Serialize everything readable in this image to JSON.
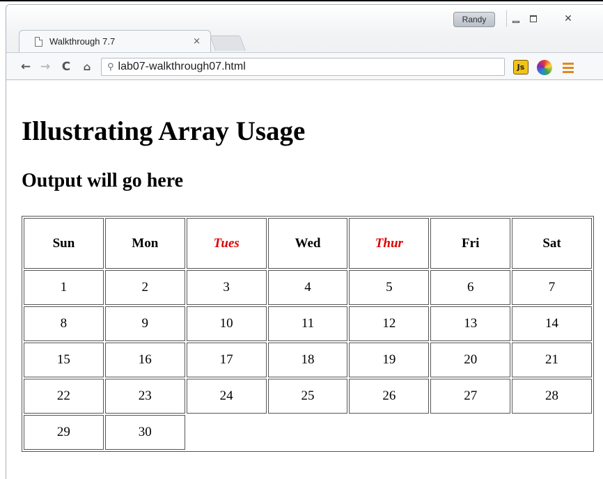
{
  "browser": {
    "user_badge": "Randy",
    "tab": {
      "title": "Walkthrough 7.7",
      "close": "×"
    },
    "address": "lab07-walkthrough07.html",
    "nav": {
      "back": "←",
      "forward": "→",
      "reload": "C",
      "home": "⌂"
    },
    "extensions": {
      "js_label": "Js"
    },
    "window_close": "✕"
  },
  "page": {
    "heading": "Illustrating Array Usage",
    "subheading": "Output will go here",
    "days": [
      {
        "label": "Sun",
        "highlight": false
      },
      {
        "label": "Mon",
        "highlight": false
      },
      {
        "label": "Tues",
        "highlight": true
      },
      {
        "label": "Wed",
        "highlight": false
      },
      {
        "label": "Thur",
        "highlight": true
      },
      {
        "label": "Fri",
        "highlight": false
      },
      {
        "label": "Sat",
        "highlight": false
      }
    ],
    "weeks": [
      [
        "1",
        "2",
        "3",
        "4",
        "5",
        "6",
        "7"
      ],
      [
        "8",
        "9",
        "10",
        "11",
        "12",
        "13",
        "14"
      ],
      [
        "15",
        "16",
        "17",
        "18",
        "19",
        "20",
        "21"
      ],
      [
        "22",
        "23",
        "24",
        "25",
        "26",
        "27",
        "28"
      ],
      [
        "29",
        "30"
      ]
    ],
    "highlight_color": "#e00000"
  }
}
